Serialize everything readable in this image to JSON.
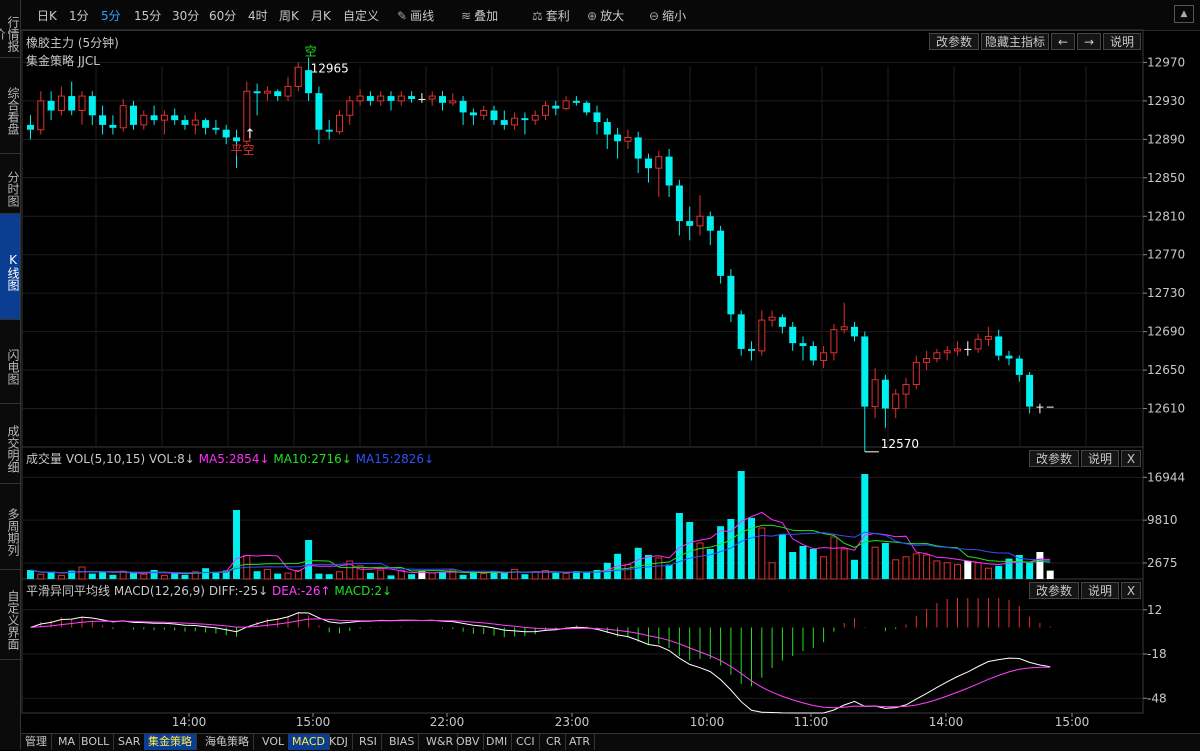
{
  "sidebar": {
    "tabs": [
      {
        "label": "行情报价",
        "active": false
      },
      {
        "label": "综合看盘",
        "active": false
      },
      {
        "label": "分时图",
        "active": false
      },
      {
        "label": "K线图",
        "active": true
      },
      {
        "label": "闪电图",
        "active": false
      },
      {
        "label": "成交明细",
        "active": false
      },
      {
        "label": "多周期列",
        "active": false
      },
      {
        "label": "自定义界面",
        "active": false
      }
    ]
  },
  "toolbar": {
    "periods": [
      {
        "label": "日K",
        "active": false
      },
      {
        "label": "1分",
        "active": false
      },
      {
        "label": "5分",
        "active": true
      },
      {
        "label": "15分",
        "active": false
      },
      {
        "label": "30分",
        "active": false
      },
      {
        "label": "60分",
        "active": false
      },
      {
        "label": "4时",
        "active": false
      },
      {
        "label": "周K",
        "active": false
      },
      {
        "label": "月K",
        "active": false
      },
      {
        "label": "自定义",
        "active": false
      }
    ],
    "tools": [
      {
        "label": "画线",
        "icon": "pencil-icon"
      },
      {
        "label": "叠加",
        "icon": "layers-icon"
      },
      {
        "label": "套利",
        "icon": "arbitrage-icon"
      },
      {
        "label": "放大",
        "icon": "zoom-in-icon"
      },
      {
        "label": "缩小",
        "icon": "zoom-out-icon"
      }
    ]
  },
  "main_panel": {
    "title": "橡胶主力 (5分钟)",
    "strategy": "集金策略 JJCL",
    "buttons": [
      "改参数",
      "隐藏主指标",
      "←",
      "→",
      "说明"
    ],
    "annotations": {
      "high_value": "12965",
      "low_value": "12570",
      "sell_signal": "空",
      "flat_signal": "平空"
    }
  },
  "volume_panel": {
    "label": "成交量",
    "params": "VOL(5,10,15)",
    "vol": "VOL:8↓",
    "ma5": "MA5:2854↓",
    "ma10": "MA10:2716↓",
    "ma15": "MA15:2826↓",
    "buttons": [
      "改参数",
      "说明",
      "X"
    ]
  },
  "macd_panel": {
    "label": "平滑异同平均线",
    "params": "MACD(12,26,9)",
    "diff": "DIFF:-25↓",
    "dea": "DEA:-26↑",
    "macd": "MACD:2↓",
    "buttons": [
      "改参数",
      "说明",
      "X"
    ]
  },
  "x_labels": [
    "14:00",
    "15:00",
    "22:00",
    "23:00",
    "10:00",
    "11:00",
    "14:00",
    "15:00"
  ],
  "bottom_tabs": [
    {
      "label": "管理",
      "active": false
    },
    {
      "label": "MA",
      "active": false
    },
    {
      "label": "BOLL",
      "active": false
    },
    {
      "label": "SAR",
      "active": false
    },
    {
      "label": "集金策略",
      "active": true
    },
    {
      "label": "海龟策略",
      "active": false
    },
    {
      "label": "VOL",
      "active": false
    },
    {
      "label": "MACD",
      "active": true
    },
    {
      "label": "KDJ",
      "active": false
    },
    {
      "label": "RSI",
      "active": false
    },
    {
      "label": "BIAS",
      "active": false
    },
    {
      "label": "W&R",
      "active": false
    },
    {
      "label": "OBV",
      "active": false
    },
    {
      "label": "DMI",
      "active": false
    },
    {
      "label": "CCI",
      "active": false
    },
    {
      "label": "CR",
      "active": false
    },
    {
      "label": "ATR",
      "active": false
    }
  ],
  "colors": {
    "up": "#e03030",
    "down": "#00f0f0",
    "flat": "#ffffff",
    "ma5": "#ff2cff",
    "ma10": "#20e020",
    "ma15": "#3050ff",
    "diff": "#ffffff",
    "dea": "#ff40ff",
    "accent": "#29a3ff"
  },
  "chart_data": [
    {
      "type": "candlestick",
      "title": "橡胶主力 (5分钟)",
      "y_ticks": [
        12970,
        12930,
        12890,
        12850,
        12810,
        12770,
        12730,
        12690,
        12650,
        12610
      ],
      "ylim": [
        12570,
        12985
      ],
      "candles": [
        [
          12905,
          12900,
          12915,
          12890
        ],
        [
          12900,
          12930,
          12940,
          12895
        ],
        [
          12930,
          12920,
          12940,
          12910
        ],
        [
          12920,
          12935,
          12945,
          12915
        ],
        [
          12935,
          12920,
          12950,
          12915
        ],
        [
          12920,
          12935,
          12940,
          12905
        ],
        [
          12935,
          12915,
          12940,
          12905
        ],
        [
          12915,
          12905,
          12925,
          12895
        ],
        [
          12905,
          12902,
          12915,
          12895
        ],
        [
          12902,
          12925,
          12932,
          12898
        ],
        [
          12925,
          12905,
          12930,
          12900
        ],
        [
          12905,
          12915,
          12920,
          12900
        ],
        [
          12915,
          12910,
          12925,
          12905
        ],
        [
          12910,
          12915,
          12920,
          12895
        ],
        [
          12915,
          12910,
          12922,
          12905
        ],
        [
          12910,
          12905,
          12915,
          12900
        ],
        [
          12905,
          12910,
          12918,
          12895
        ],
        [
          12910,
          12902,
          12912,
          12895
        ],
        [
          12902,
          12900,
          12910,
          12895
        ],
        [
          12900,
          12892,
          12905,
          12885
        ],
        [
          12892,
          12888,
          12900,
          12860
        ],
        [
          12888,
          12940,
          12950,
          12885
        ],
        [
          12940,
          12938,
          12948,
          12915
        ],
        [
          12938,
          12940,
          12945,
          12930
        ],
        [
          12940,
          12935,
          12942,
          12930
        ],
        [
          12935,
          12945,
          12955,
          12930
        ],
        [
          12945,
          12965,
          12970,
          12940
        ],
        [
          12962,
          12938,
          12975,
          12930
        ],
        [
          12938,
          12900,
          12945,
          12885
        ],
        [
          12900,
          12898,
          12910,
          12890
        ],
        [
          12898,
          12915,
          12920,
          12895
        ],
        [
          12915,
          12930,
          12935,
          12905
        ],
        [
          12930,
          12935,
          12942,
          12925
        ],
        [
          12935,
          12930,
          12940,
          12925
        ],
        [
          12930,
          12935,
          12940,
          12925
        ],
        [
          12935,
          12930,
          12940,
          12920
        ],
        [
          12930,
          12935,
          12940,
          12925
        ],
        [
          12935,
          12932,
          12940,
          12928
        ],
        [
          12932,
          12932,
          12938,
          12928
        ],
        [
          12932,
          12935,
          12940,
          12925
        ],
        [
          12935,
          12928,
          12940,
          12920
        ],
        [
          12928,
          12930,
          12938,
          12925
        ],
        [
          12930,
          12918,
          12935,
          12905
        ],
        [
          12918,
          12915,
          12922,
          12905
        ],
        [
          12915,
          12920,
          12925,
          12910
        ],
        [
          12920,
          12910,
          12925,
          12905
        ],
        [
          12910,
          12905,
          12920,
          12900
        ],
        [
          12905,
          12912,
          12918,
          12900
        ],
        [
          12912,
          12910,
          12918,
          12895
        ],
        [
          12910,
          12915,
          12920,
          12905
        ],
        [
          12915,
          12925,
          12930,
          12910
        ],
        [
          12925,
          12922,
          12930,
          12915
        ],
        [
          12922,
          12930,
          12935,
          12920
        ],
        [
          12930,
          12928,
          12935,
          12925
        ],
        [
          12928,
          12918,
          12930,
          12915
        ],
        [
          12918,
          12908,
          12925,
          12895
        ],
        [
          12908,
          12895,
          12912,
          12880
        ],
        [
          12895,
          12888,
          12902,
          12870
        ],
        [
          12888,
          12892,
          12900,
          12880
        ],
        [
          12892,
          12870,
          12898,
          12855
        ],
        [
          12870,
          12860,
          12875,
          12845
        ],
        [
          12860,
          12872,
          12878,
          12830
        ],
        [
          12872,
          12842,
          12880,
          12830
        ],
        [
          12842,
          12805,
          12848,
          12790
        ],
        [
          12805,
          12800,
          12820,
          12785
        ],
        [
          12800,
          12810,
          12832,
          12790
        ],
        [
          12810,
          12795,
          12815,
          12780
        ],
        [
          12795,
          12748,
          12800,
          12740
        ],
        [
          12748,
          12708,
          12755,
          12700
        ],
        [
          12708,
          12672,
          12712,
          12665
        ],
        [
          12672,
          12670,
          12680,
          12660
        ],
        [
          12670,
          12702,
          12712,
          12665
        ],
        [
          12702,
          12705,
          12712,
          12695
        ],
        [
          12705,
          12695,
          12708,
          12688
        ],
        [
          12695,
          12678,
          12700,
          12670
        ],
        [
          12678,
          12675,
          12685,
          12660
        ],
        [
          12675,
          12660,
          12680,
          12655
        ],
        [
          12660,
          12668,
          12675,
          12652
        ],
        [
          12668,
          12692,
          12698,
          12660
        ],
        [
          12692,
          12695,
          12720,
          12688
        ],
        [
          12695,
          12685,
          12700,
          12680
        ],
        [
          12685,
          12612,
          12690,
          12565
        ],
        [
          12612,
          12640,
          12652,
          12600
        ],
        [
          12640,
          12610,
          12645,
          12590
        ],
        [
          12610,
          12625,
          12630,
          12600
        ],
        [
          12625,
          12635,
          12642,
          12610
        ],
        [
          12635,
          12658,
          12665,
          12630
        ],
        [
          12658,
          12662,
          12670,
          12650
        ],
        [
          12662,
          12668,
          12672,
          12658
        ],
        [
          12668,
          12670,
          12675,
          12660
        ],
        [
          12670,
          12672,
          12680,
          12665
        ],
        [
          12672,
          12672,
          12680,
          12665
        ],
        [
          12672,
          12682,
          12688,
          12668
        ],
        [
          12682,
          12685,
          12695,
          12675
        ],
        [
          12685,
          12665,
          12692,
          12660
        ],
        [
          12665,
          12662,
          12670,
          12655
        ],
        [
          12662,
          12645,
          12665,
          12638
        ],
        [
          12645,
          12612,
          12648,
          12605
        ],
        [
          12612,
          12612,
          12615,
          12605
        ],
        [
          12612,
          12612,
          12612,
          12612
        ]
      ]
    },
    {
      "type": "bar",
      "title": "成交量",
      "y_ticks": [
        16944,
        9810,
        2675
      ],
      "ylim": [
        0,
        18500
      ],
      "values": [
        1500,
        800,
        1200,
        600,
        1400,
        2000,
        900,
        1100,
        700,
        1300,
        1000,
        800,
        1500,
        600,
        900,
        700,
        1200,
        1800,
        1100,
        1400,
        11500,
        3900,
        1300,
        1600,
        900,
        1000,
        1400,
        6500,
        900,
        800,
        1200,
        3000,
        2200,
        1000,
        1500,
        600,
        1400,
        800,
        1300,
        1000,
        1200,
        1500,
        700,
        1100,
        900,
        1300,
        1000,
        1600,
        800,
        1200,
        1400,
        1000,
        900,
        1300,
        1100,
        1500,
        2700,
        4200,
        2400,
        5200,
        4000,
        3500,
        2400,
        11000,
        9500,
        6000,
        5000,
        8800,
        10000,
        18000,
        10200,
        8500,
        2700,
        7500,
        4500,
        5500,
        5000,
        3700,
        7000,
        5000,
        3200,
        17500,
        5300,
        6000,
        3200,
        3700,
        4200,
        4000,
        3000,
        2700,
        2400,
        3000,
        2700,
        1800,
        2200,
        3400,
        4000,
        2700,
        4500,
        1400
      ]
    },
    {
      "type": "bar",
      "title": "平滑异同平均线",
      "y_ticks": [
        12,
        -18,
        -48
      ],
      "ylim": [
        -58,
        20
      ]
    }
  ]
}
